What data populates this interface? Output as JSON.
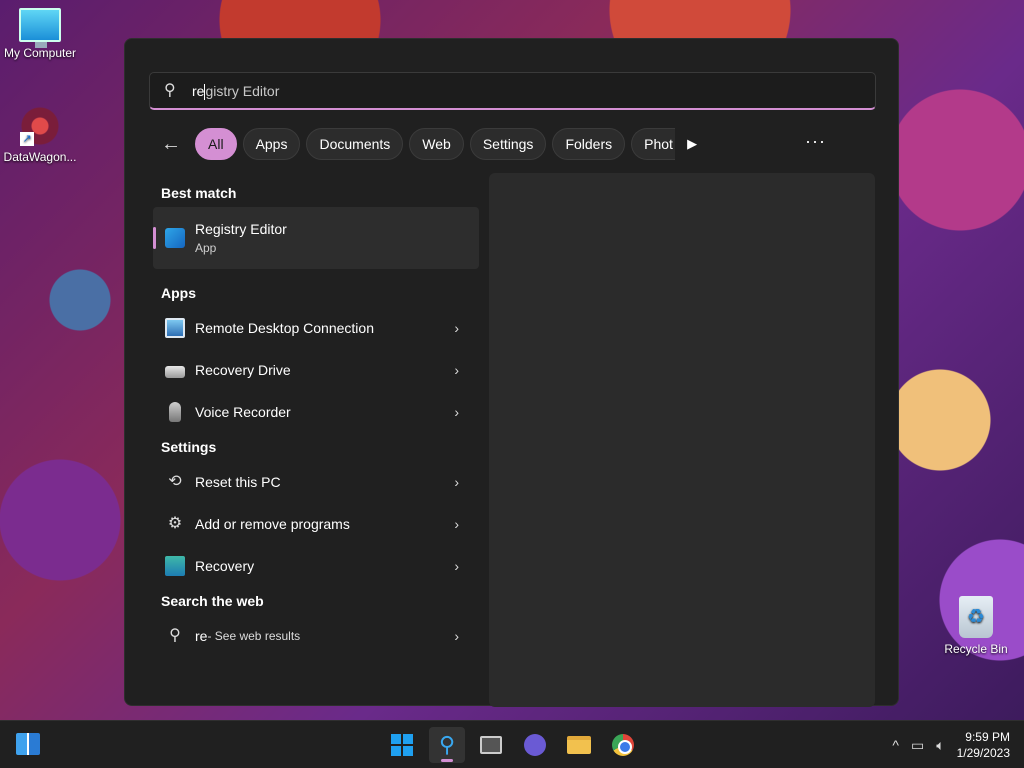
{
  "desktop": {
    "icons": [
      {
        "label": "My Computer",
        "icon": "monitor-icon"
      },
      {
        "label": "DataWagon...",
        "icon": "app-shortcut-icon"
      },
      {
        "label": "Recycle Bin",
        "icon": "recycle-bin-icon"
      }
    ]
  },
  "search": {
    "typed": "re",
    "suggestion": "gistry Editor"
  },
  "filters": {
    "back_icon": "back-arrow-icon",
    "chips": [
      "All",
      "Apps",
      "Documents",
      "Web",
      "Settings",
      "Folders",
      "Phot"
    ],
    "active": "All",
    "more_icon": "more-ellipsis-icon"
  },
  "results": {
    "best_match_title": "Best match",
    "best_match": {
      "name": "Registry Editor",
      "type": "App",
      "icon": "registry-editor-icon"
    },
    "apps_title": "Apps",
    "apps": [
      {
        "name": "Remote Desktop Connection",
        "icon": "remote-desktop-icon"
      },
      {
        "name": "Recovery Drive",
        "icon": "drive-icon"
      },
      {
        "name": "Voice Recorder",
        "icon": "microphone-icon"
      }
    ],
    "settings_title": "Settings",
    "settings": [
      {
        "name": "Reset this PC",
        "icon": "reset-icon"
      },
      {
        "name": "Add or remove programs",
        "icon": "gear-icon"
      },
      {
        "name": "Recovery",
        "icon": "recovery-icon"
      }
    ],
    "web_title": "Search the web",
    "web": {
      "query": "re",
      "suffix": " - See web results",
      "icon": "search-icon"
    }
  },
  "taskbar": {
    "apps": [
      "start",
      "search",
      "task-view",
      "chat",
      "file-explorer",
      "chrome"
    ],
    "clock": {
      "time": "9:59 PM",
      "date": "1/29/2023"
    },
    "accent": "#d48fd3"
  }
}
